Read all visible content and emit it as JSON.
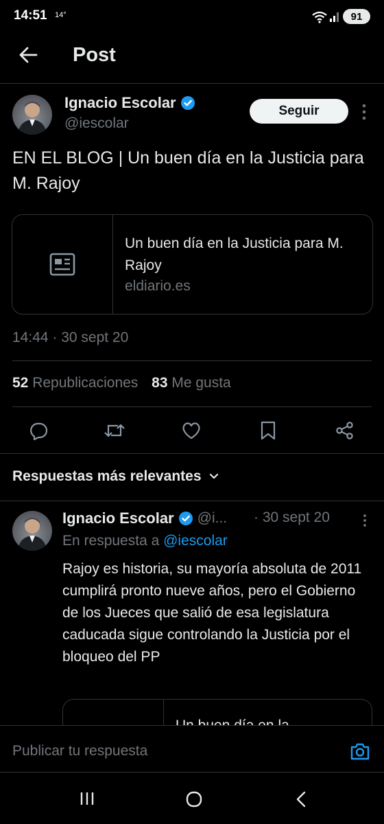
{
  "status_bar": {
    "time": "14:51",
    "temperature": "14°",
    "battery": "91"
  },
  "header": {
    "title": "Post"
  },
  "post": {
    "author_name": "Ignacio Escolar",
    "author_handle": "@iescolar",
    "follow_label": "Seguir",
    "text": "EN EL BLOG | Un buen día en la Justicia para M. Rajoy",
    "card": {
      "title": "Un buen día en la Justicia para M. Rajoy",
      "domain": "eldiario.es"
    },
    "timestamp": "14:44 · 30 sept 20",
    "reposts_count": "52",
    "reposts_label": "Republicaciones",
    "likes_count": "83",
    "likes_label": "Me gusta"
  },
  "replies": {
    "sort_label": "Respuestas más relevantes",
    "items": [
      {
        "author_name": "Ignacio Escolar",
        "author_handle": "@i...",
        "date": "· 30 sept 20",
        "in_reply_prefix": "En respuesta a",
        "in_reply_handle": "@iescolar",
        "text": "Rajoy es historia, su mayoría absoluta de 2011 cumplirá pronto nueve años, pero el Gobierno de los Jueces que salió de esa legislatura caducada sigue controlando la Justicia por el bloqueo del PP",
        "card_title_partial": "Un buen día en la"
      }
    ]
  },
  "compose": {
    "placeholder": "Publicar tu respuesta"
  },
  "colors": {
    "background": "#000000",
    "text": "#e7e9ea",
    "muted": "#71767b",
    "accent": "#1d9bf0",
    "divider": "#2f3336"
  }
}
